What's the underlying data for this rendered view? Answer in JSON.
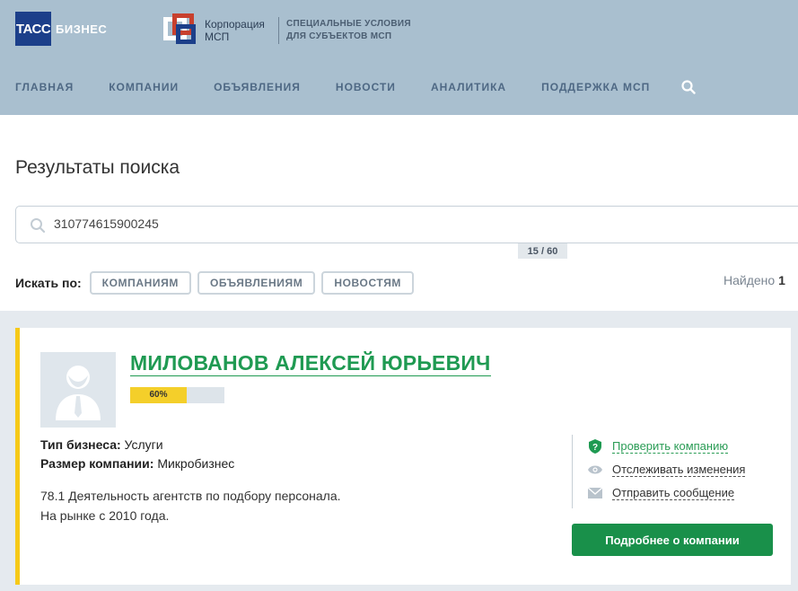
{
  "header": {
    "tass_logo": "ТАСС",
    "tass_sub": "БИЗНЕС",
    "msp_name": "Корпорация МСП",
    "msp_desc": "СПЕЦИАЛЬНЫЕ УСЛОВИЯ ДЛЯ СУБЪЕКТОВ МСП",
    "nav": [
      "ГЛАВНАЯ",
      "КОМПАНИИ",
      "ОБЪЯВЛЕНИЯ",
      "НОВОСТИ",
      "АНАЛИТИКА",
      "ПОДДЕРЖКА МСП"
    ],
    "nav_search_icon": "search-icon"
  },
  "main": {
    "title": "Результаты поиска",
    "search_value": "310774615900245",
    "counter": "15 / 60",
    "filter_label": "Искать по:",
    "filters": [
      "КОМПАНИЯМ",
      "ОБЪЯВЛЕНИЯМ",
      "НОВОСТЯМ"
    ],
    "found_label": "Найдено",
    "found_count": "1"
  },
  "result": {
    "name": "МИЛОВАНОВ АЛЕКСЕЙ ЮРЬЕВИЧ",
    "progress_label": "60%",
    "progress_fraction": 0.6,
    "business_type_key": "Тип бизнеса:",
    "business_type_val": "Услуги",
    "company_size_key": "Размер компании:",
    "company_size_val": "Микробизнес",
    "activity": "78.1 Деятельность агентств по подбору персонала.",
    "on_market": "На рынке с 2010 года.",
    "actions": [
      "Проверить компанию",
      "Отслеживать изменения",
      "Отправить сообщение"
    ],
    "more_button": "Подробнее о компании"
  },
  "colors": {
    "header_bg": "#a9bfcf",
    "accent_green": "#1f9a52",
    "card_stripe": "#f6c918",
    "button_green": "#19904a"
  }
}
